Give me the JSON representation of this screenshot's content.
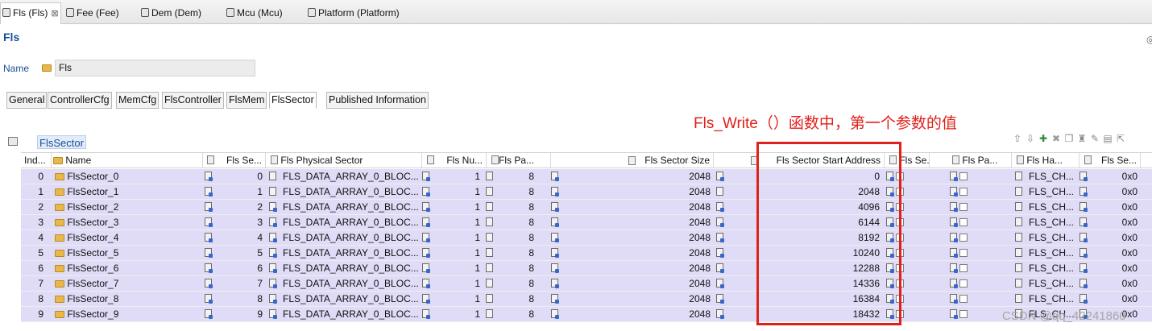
{
  "editor_tabs": [
    {
      "label": "Fls (Fls)",
      "active": true
    },
    {
      "label": "Fee (Fee)",
      "active": false
    },
    {
      "label": "Dem (Dem)",
      "active": false
    },
    {
      "label": "Mcu (Mcu)",
      "active": false
    },
    {
      "label": "Platform (Platform)",
      "active": false
    }
  ],
  "form": {
    "title": "Fls",
    "name_label": "Name",
    "name_value": "Fls"
  },
  "main_tabs": [
    "General",
    "ControllerCfg",
    "MemCfg",
    "FlsController",
    "FlsMem",
    "FlsSector",
    "Published Information"
  ],
  "main_tab_active": "FlsSector",
  "section": {
    "title": "FlsSector"
  },
  "annotation": "Fls_Write（）函数中，第一个参数的值",
  "table": {
    "headers": [
      "Ind...",
      "Name",
      "Fls Se...",
      "Fls Physical Sector",
      "Fls Nu...",
      "Fls Pa...",
      "Fls Sector Size",
      "Fls Sector Start Address",
      "Fls Se...",
      "Fls Pa...",
      "Fls Ha...",
      "Fls Se..."
    ],
    "rows": [
      {
        "idx": "0",
        "name": "FlsSector_0",
        "se": "0",
        "phys": "FLS_DATA_ARRAY_0_BLOC...",
        "nu": "1",
        "pa": "8",
        "size": "2048",
        "start": "0",
        "ha": "FLS_CH...",
        "se2": "0x0"
      },
      {
        "idx": "1",
        "name": "FlsSector_1",
        "se": "1",
        "phys": "FLS_DATA_ARRAY_0_BLOC...",
        "nu": "1",
        "pa": "8",
        "size": "2048",
        "start": "2048",
        "ha": "FLS_CH...",
        "se2": "0x0"
      },
      {
        "idx": "2",
        "name": "FlsSector_2",
        "se": "2",
        "phys": "FLS_DATA_ARRAY_0_BLOC...",
        "nu": "1",
        "pa": "8",
        "size": "2048",
        "start": "4096",
        "ha": "FLS_CH...",
        "se2": "0x0"
      },
      {
        "idx": "3",
        "name": "FlsSector_3",
        "se": "3",
        "phys": "FLS_DATA_ARRAY_0_BLOC...",
        "nu": "1",
        "pa": "8",
        "size": "2048",
        "start": "6144",
        "ha": "FLS_CH...",
        "se2": "0x0"
      },
      {
        "idx": "4",
        "name": "FlsSector_4",
        "se": "4",
        "phys": "FLS_DATA_ARRAY_0_BLOC...",
        "nu": "1",
        "pa": "8",
        "size": "2048",
        "start": "8192",
        "ha": "FLS_CH...",
        "se2": "0x0"
      },
      {
        "idx": "5",
        "name": "FlsSector_5",
        "se": "5",
        "phys": "FLS_DATA_ARRAY_0_BLOC...",
        "nu": "1",
        "pa": "8",
        "size": "2048",
        "start": "10240",
        "ha": "FLS_CH...",
        "se2": "0x0"
      },
      {
        "idx": "6",
        "name": "FlsSector_6",
        "se": "6",
        "phys": "FLS_DATA_ARRAY_0_BLOC...",
        "nu": "1",
        "pa": "8",
        "size": "2048",
        "start": "12288",
        "ha": "FLS_CH...",
        "se2": "0x0"
      },
      {
        "idx": "7",
        "name": "FlsSector_7",
        "se": "7",
        "phys": "FLS_DATA_ARRAY_0_BLOC...",
        "nu": "1",
        "pa": "8",
        "size": "2048",
        "start": "14336",
        "ha": "FLS_CH...",
        "se2": "0x0"
      },
      {
        "idx": "8",
        "name": "FlsSector_8",
        "se": "8",
        "phys": "FLS_DATA_ARRAY_0_BLOC...",
        "nu": "1",
        "pa": "8",
        "size": "2048",
        "start": "16384",
        "ha": "FLS_CH...",
        "se2": "0x0"
      },
      {
        "idx": "9",
        "name": "FlsSector_9",
        "se": "9",
        "phys": "FLS_DATA_ARRAY_0_BLOC...",
        "nu": "1",
        "pa": "8",
        "size": "2048",
        "start": "18432",
        "ha": "FLS_CH...",
        "se2": "0x0"
      }
    ]
  },
  "watermark": "CSDN @qq_42241860",
  "colors": {
    "row_bg": "#e0dcf7",
    "highlight": "#e0201b",
    "link_blue": "#1a4f9c"
  }
}
